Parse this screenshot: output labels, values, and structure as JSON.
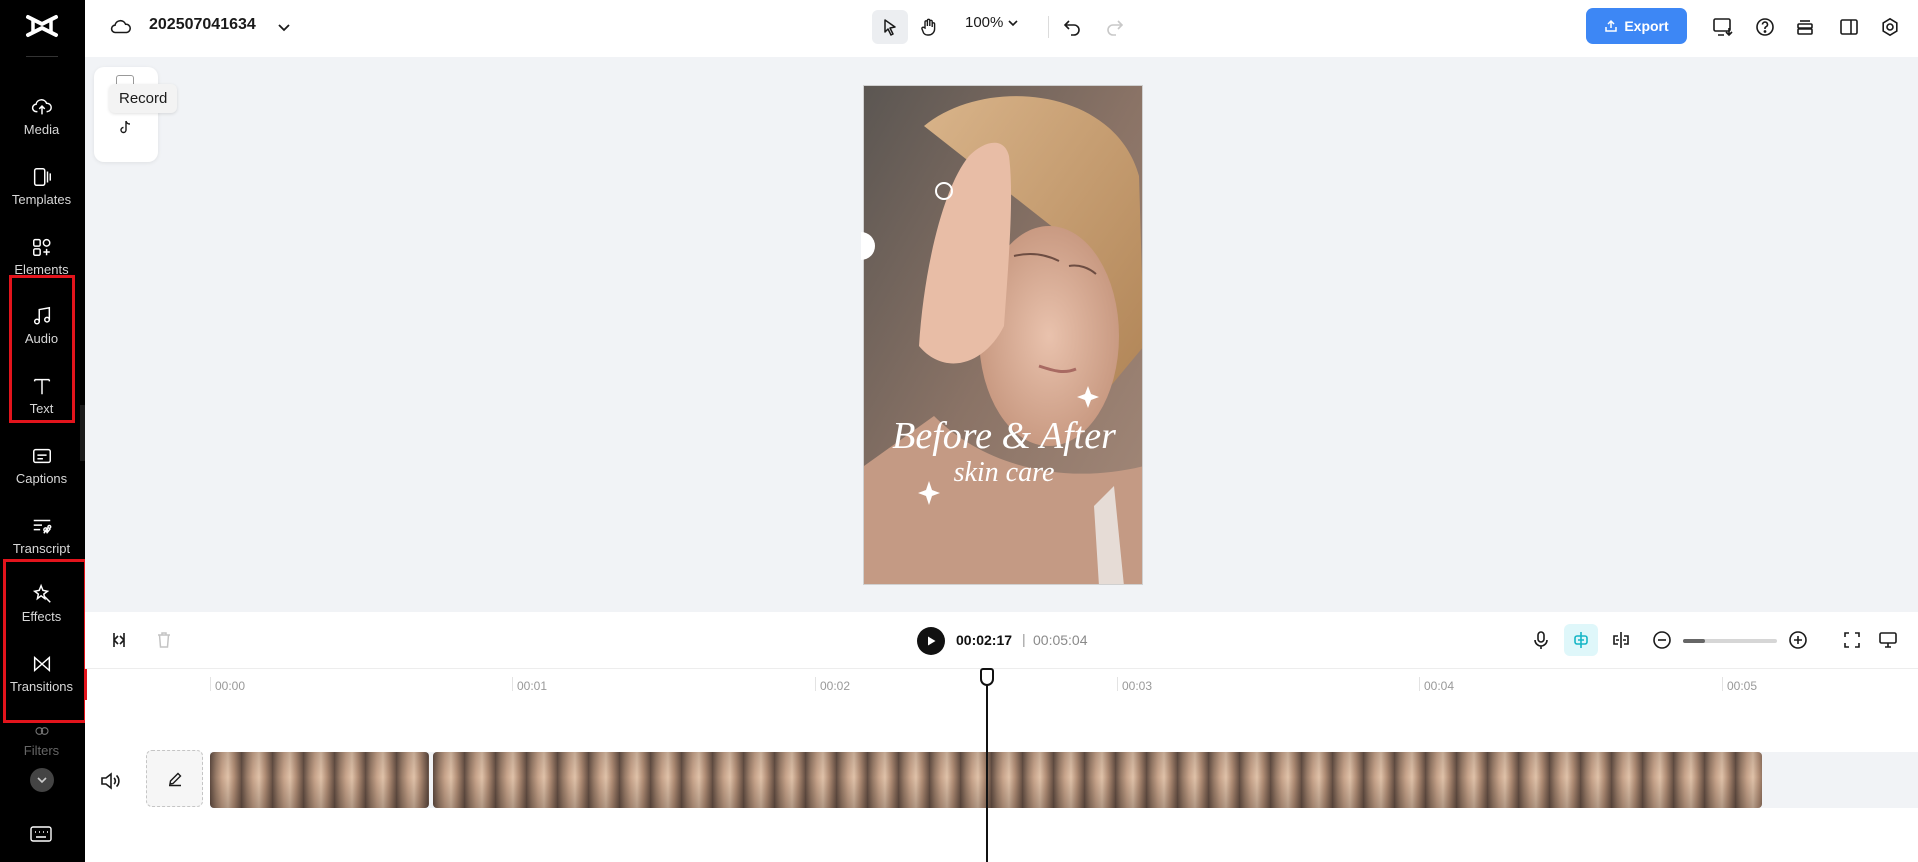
{
  "project": {
    "name": "202507041634"
  },
  "sidebar": {
    "items": [
      {
        "id": "media",
        "label": "Media"
      },
      {
        "id": "templates",
        "label": "Templates"
      },
      {
        "id": "elements",
        "label": "Elements"
      },
      {
        "id": "audio",
        "label": "Audio"
      },
      {
        "id": "text",
        "label": "Text"
      },
      {
        "id": "captions",
        "label": "Captions"
      },
      {
        "id": "transcript",
        "label": "Transcript"
      },
      {
        "id": "effects",
        "label": "Effects"
      },
      {
        "id": "transitions",
        "label": "Transitions"
      },
      {
        "id": "filters",
        "label": "Filters"
      }
    ],
    "highlight_color": "#e3141c"
  },
  "toolbar": {
    "zoom": "100%",
    "export_label": "Export",
    "accent": "#3d87f5"
  },
  "floating_panel": {
    "tooltip": "Record"
  },
  "preview": {
    "title_line1": "Before & After",
    "title_line2": "skin care"
  },
  "playback": {
    "current_time": "00:02:17",
    "separator": "|",
    "total_time": "00:05:04"
  },
  "ruler": {
    "ticks": [
      "00:00",
      "00:01",
      "00:02",
      "00:03",
      "00:04",
      "00:05"
    ]
  },
  "icons": {
    "cloud": "cloud-icon",
    "select": "pointer-icon",
    "hand": "hand-icon",
    "undo": "undo-icon",
    "redo": "redo-icon",
    "mic": "microphone-icon",
    "split": "split-icon"
  }
}
